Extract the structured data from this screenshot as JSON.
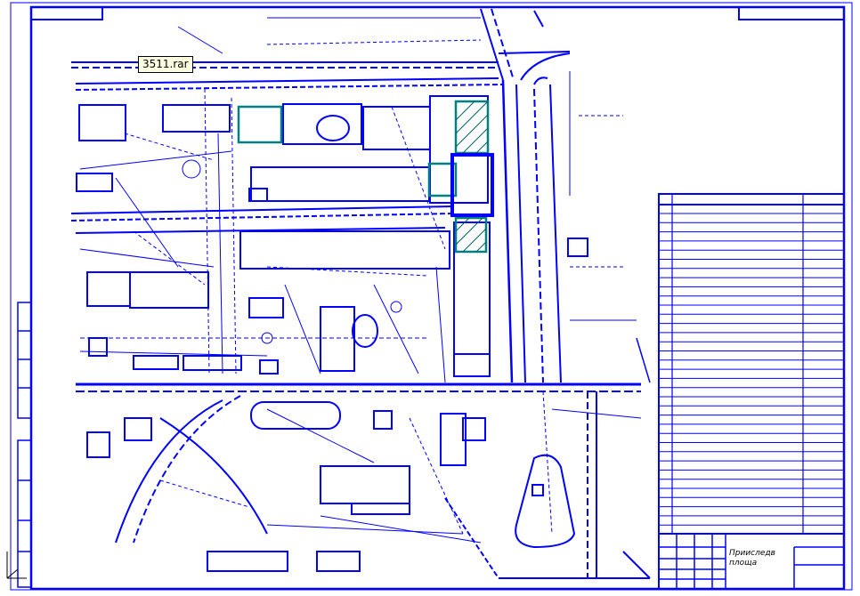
{
  "tooltip": {
    "text": "3511.rar"
  },
  "title_block": {
    "title": "Прииследв площа"
  },
  "colors": {
    "line": "#0000ff",
    "accent": "#008080",
    "text": "#000000",
    "background": "#ffffff"
  },
  "icons": [
    "3d-axis-icon"
  ]
}
